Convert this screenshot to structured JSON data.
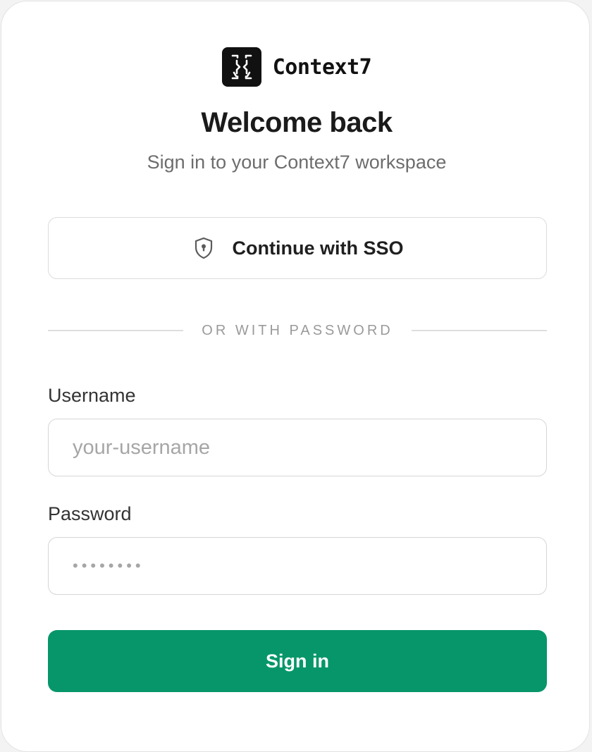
{
  "brand": {
    "name": "Context7",
    "logo_icon": "context7-logo-icon"
  },
  "header": {
    "title": "Welcome back",
    "subtitle": "Sign in to your Context7 workspace"
  },
  "sso": {
    "label": "Continue with SSO",
    "icon": "shield-lock-icon"
  },
  "divider": {
    "text": "OR WITH PASSWORD"
  },
  "form": {
    "username": {
      "label": "Username",
      "placeholder": "your-username",
      "value": ""
    },
    "password": {
      "label": "Password",
      "placeholder": "••••••••",
      "value": ""
    },
    "submit_label": "Sign in"
  },
  "colors": {
    "primary": "#069669",
    "logo_bg": "#111111",
    "text": "#1a1a1a",
    "muted": "#6d6d6d",
    "border": "#dcdcdc"
  }
}
